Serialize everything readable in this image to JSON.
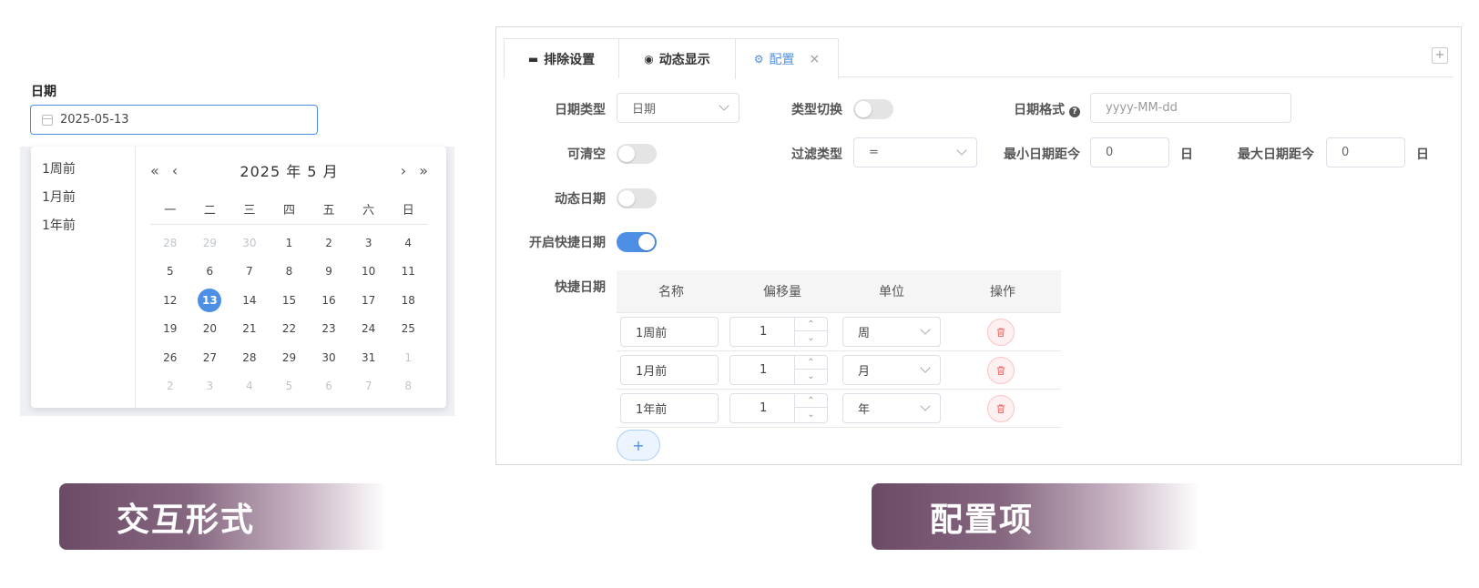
{
  "date_picker": {
    "label": "日期",
    "value": "2025-05-13",
    "shortcuts": [
      "1周前",
      "1月前",
      "1年前"
    ],
    "nav": {
      "prev_year": "«",
      "prev_month": "‹",
      "next_month": "›",
      "next_year": "»"
    },
    "title": "2025 年  5 月",
    "weekdays": [
      "一",
      "二",
      "三",
      "四",
      "五",
      "六",
      "日"
    ],
    "days": [
      {
        "d": "28",
        "other": true
      },
      {
        "d": "29",
        "other": true
      },
      {
        "d": "30",
        "other": true
      },
      {
        "d": "1"
      },
      {
        "d": "2"
      },
      {
        "d": "3"
      },
      {
        "d": "4"
      },
      {
        "d": "5"
      },
      {
        "d": "6"
      },
      {
        "d": "7"
      },
      {
        "d": "8"
      },
      {
        "d": "9"
      },
      {
        "d": "10"
      },
      {
        "d": "11"
      },
      {
        "d": "12"
      },
      {
        "d": "13",
        "selected": true
      },
      {
        "d": "14"
      },
      {
        "d": "15"
      },
      {
        "d": "16"
      },
      {
        "d": "17"
      },
      {
        "d": "18"
      },
      {
        "d": "19"
      },
      {
        "d": "20"
      },
      {
        "d": "21"
      },
      {
        "d": "22"
      },
      {
        "d": "23"
      },
      {
        "d": "24"
      },
      {
        "d": "25"
      },
      {
        "d": "26"
      },
      {
        "d": "27"
      },
      {
        "d": "28"
      },
      {
        "d": "29"
      },
      {
        "d": "30"
      },
      {
        "d": "31"
      },
      {
        "d": "1",
        "other": true
      },
      {
        "d": "2",
        "other": true
      },
      {
        "d": "3",
        "other": true
      },
      {
        "d": "4",
        "other": true
      },
      {
        "d": "5",
        "other": true
      },
      {
        "d": "6",
        "other": true
      },
      {
        "d": "7",
        "other": true
      },
      {
        "d": "8",
        "other": true
      }
    ]
  },
  "config": {
    "tabs": {
      "exclude": "排除设置",
      "dynamic": "动态显示",
      "config": "配置",
      "close": "×",
      "add": "+"
    },
    "date_type": {
      "label": "日期类型",
      "value": "日期"
    },
    "type_switch": {
      "label": "类型切换",
      "on": false
    },
    "date_format": {
      "label": "日期格式",
      "placeholder": "yyyy-MM-dd"
    },
    "clearable": {
      "label": "可清空",
      "on": false
    },
    "filter_type": {
      "label": "过滤类型",
      "value": "="
    },
    "min_days": {
      "label": "最小日期距今",
      "value": "0",
      "unit": "日"
    },
    "max_days": {
      "label": "最大日期距今",
      "value": "0",
      "unit": "日"
    },
    "dynamic_date": {
      "label": "动态日期",
      "on": false
    },
    "quick_date_enabled": {
      "label": "开启快捷日期",
      "on": true
    },
    "quick_dates": {
      "label": "快捷日期",
      "columns": [
        "名称",
        "偏移量",
        "单位",
        "操作"
      ],
      "rows": [
        {
          "name": "1周前",
          "offset": "1",
          "unit": "周"
        },
        {
          "name": "1月前",
          "offset": "1",
          "unit": "月"
        },
        {
          "name": "1年前",
          "offset": "1",
          "unit": "年"
        }
      ],
      "add_label": "+"
    }
  },
  "banners": {
    "left": "交互形式",
    "right": "配置项"
  },
  "colors": {
    "accent": "#4e8fe6",
    "danger": "#f56c6c",
    "banner": "#6b4a65"
  }
}
